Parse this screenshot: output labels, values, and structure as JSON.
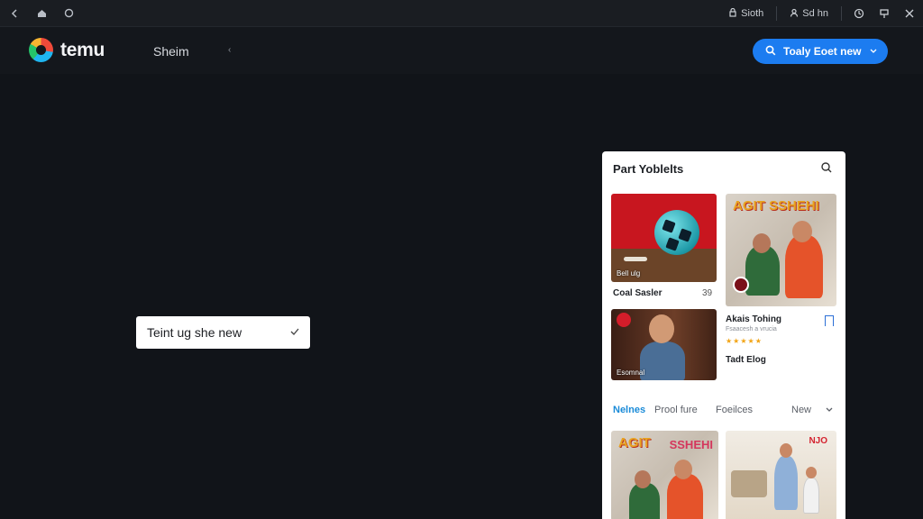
{
  "browser": {
    "right_items": [
      {
        "label": "Sioth",
        "icon": "lock-icon"
      },
      {
        "label": "Sd hn",
        "icon": "user-icon"
      }
    ]
  },
  "header": {
    "logo_text": "temu",
    "nav_link": "Sheim",
    "cta_label": "Toaly Eoet new"
  },
  "dropdown": {
    "value": "Teint ug she new"
  },
  "panel": {
    "title": "Part Yoblelts",
    "cards": [
      {
        "image_label": "Bell ulg",
        "caption": "Coal Sasler",
        "count": "39"
      },
      {
        "image_title": "AGIT SSHEHI",
        "caption": "Akais Tohing",
        "caption_sub": "Fsaacesh a vrucia",
        "rating": "★★★★★"
      },
      {
        "image_label": "Esomnal",
        "caption": "Tadt Elog"
      }
    ],
    "tabs": [
      {
        "label": "Nelnes",
        "active": true
      },
      {
        "label": "Prool fure",
        "active": false
      },
      {
        "label": "Foeilces",
        "active": false
      },
      {
        "label": "New",
        "active": false
      }
    ],
    "bottom_left_title": "AGIT",
    "bottom_left_title2": "SSHEHI",
    "bottom_right_badge": "NJO"
  },
  "colors": {
    "background": "#111419",
    "accent": "#1c7cf0",
    "tab_active": "#1a8bd8"
  }
}
